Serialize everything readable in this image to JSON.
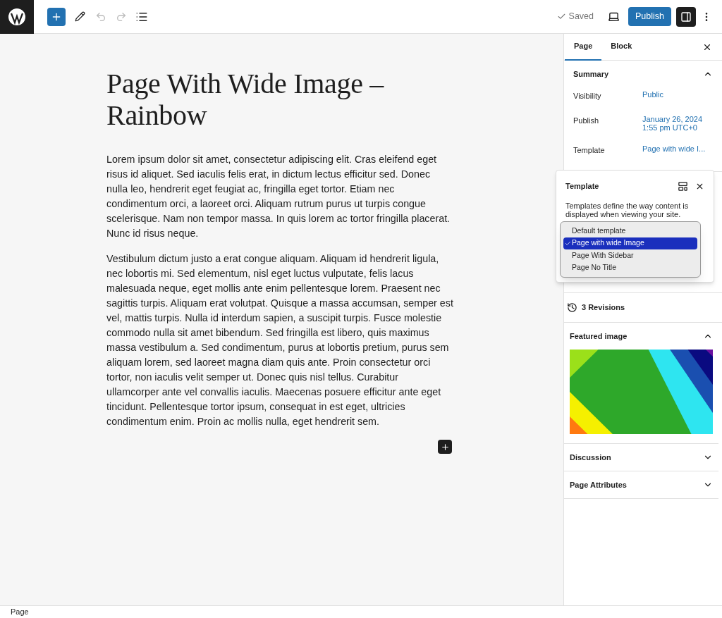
{
  "toolbar": {
    "saved": "Saved",
    "publish": "Publish"
  },
  "title": "Page With Wide Image – Rainbow",
  "paragraphs": [
    "Lorem ipsum dolor sit amet, consectetur adipiscing elit. Cras eleifend eget risus id aliquet. Sed iaculis felis erat, in dictum lectus efficitur sed. Donec nulla leo, hendrerit eget feugiat ac, fringilla eget tortor. Etiam nec condimentum orci, a laoreet orci. Aliquam rutrum purus ut turpis congue scelerisque. Nam non tempor massa. In quis lorem ac tortor fringilla placerat. Nunc id risus neque.",
    "Vestibulum dictum justo a erat congue aliquam. Aliquam id hendrerit ligula, nec lobortis mi. Sed elementum, nisl eget luctus vulputate, felis lacus malesuada neque, eget mollis ante enim pellentesque lorem. Praesent nec sagittis turpis. Aliquam erat volutpat. Quisque a massa accumsan, semper est vel, mattis turpis. Nulla id interdum sapien, a suscipit turpis. Fusce molestie commodo nulla sit amet bibendum. Sed fringilla est libero, quis maximus massa vestibulum a. Sed condimentum, purus at lobortis pretium, purus sem aliquam lorem, sed laoreet magna diam quis ante. Proin consectetur orci tortor, non iaculis velit semper ut. Donec quis nisl tellus. Curabitur ullamcorper ante vel convallis iaculis. Maecenas posuere efficitur ante eget tincidunt. Pellentesque tortor ipsum, consequat in est eget, ultricies condimentum enim. Proin ac mollis nulla, eget hendrerit sem."
  ],
  "sidebar": {
    "tabs": [
      {
        "label": "Page",
        "selected": true
      },
      {
        "label": "Block",
        "selected": false
      }
    ],
    "summary": {
      "title": "Summary",
      "expanded": true,
      "rows": [
        {
          "label": "Visibility",
          "value": "Public"
        },
        {
          "label": "Publish",
          "value": "January 26, 2024\n1:55 pm UTC+0"
        },
        {
          "label": "Template",
          "value": "Page with wide I..."
        }
      ]
    },
    "template_popover": {
      "title": "Template",
      "description": "Templates define the way content is displayed when viewing your site.",
      "options": [
        {
          "label": "Default template",
          "selected": false
        },
        {
          "label": "Page with wide Image",
          "selected": true
        },
        {
          "label": "Page With Sidebar",
          "selected": false
        },
        {
          "label": "Page No Title",
          "selected": false
        }
      ]
    },
    "revisions": "3 Revisions",
    "panels": [
      {
        "title": "Featured image",
        "expanded": true
      },
      {
        "title": "Discussion",
        "expanded": false
      },
      {
        "title": "Page Attributes",
        "expanded": false
      }
    ]
  },
  "status_bar": "Page"
}
